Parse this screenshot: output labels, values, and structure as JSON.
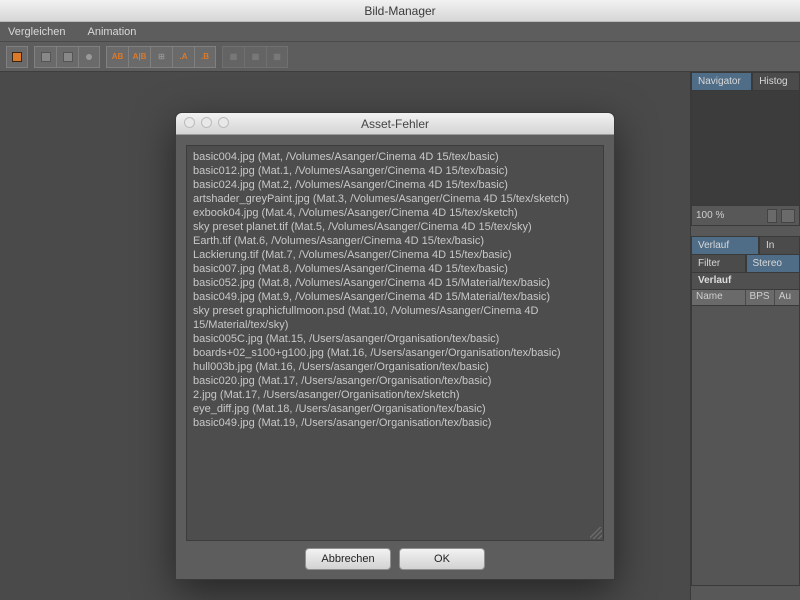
{
  "window": {
    "title": "Bild-Manager"
  },
  "menubar": {
    "items": [
      "Vergleichen",
      "Animation"
    ]
  },
  "sidepanel": {
    "tabs_top": [
      {
        "label": "Navigator",
        "active": true
      },
      {
        "label": "Histog",
        "active": false
      }
    ],
    "zoom": {
      "value": "100 %"
    },
    "tabs_mid": [
      {
        "label": "Verlauf",
        "active": true
      },
      {
        "label": "In",
        "active": false
      }
    ],
    "tabs_low": [
      {
        "label": "Filter",
        "active": false
      },
      {
        "label": "Stereo",
        "active": true
      }
    ],
    "section": {
      "title": "Verlauf"
    },
    "columns": [
      "Name",
      "BPS",
      "Au"
    ]
  },
  "dialog": {
    "title": "Asset-Fehler",
    "lines": [
      "basic004.jpg (Mat, /Volumes/Asanger/Cinema 4D 15/tex/basic)",
      "basic012.jpg (Mat.1, /Volumes/Asanger/Cinema 4D 15/tex/basic)",
      "basic024.jpg (Mat.2, /Volumes/Asanger/Cinema 4D 15/tex/basic)",
      "artshader_greyPaint.jpg (Mat.3, /Volumes/Asanger/Cinema 4D 15/tex/sketch)",
      "exbook04.jpg (Mat.4, /Volumes/Asanger/Cinema 4D 15/tex/sketch)",
      "sky preset planet.tif (Mat.5, /Volumes/Asanger/Cinema 4D 15/tex/sky)",
      "Earth.tif (Mat.6, /Volumes/Asanger/Cinema 4D 15/tex/basic)",
      "Lackierung.tif (Mat.7, /Volumes/Asanger/Cinema 4D 15/tex/basic)",
      "basic007.jpg (Mat.8, /Volumes/Asanger/Cinema 4D 15/tex/basic)",
      "basic052.jpg (Mat.8, /Volumes/Asanger/Cinema 4D 15/Material/tex/basic)",
      "basic049.jpg (Mat.9, /Volumes/Asanger/Cinema 4D 15/Material/tex/basic)",
      "sky preset graphicfullmoon.psd (Mat.10, /Volumes/Asanger/Cinema 4D 15/Material/tex/sky)",
      "basic005C.jpg (Mat.15, /Users/asanger/Organisation/tex/basic)",
      "boards+02_s100+g100.jpg (Mat.16, /Users/asanger/Organisation/tex/basic)",
      "hull003b.jpg (Mat.16, /Users/asanger/Organisation/tex/basic)",
      "basic020.jpg (Mat.17, /Users/asanger/Organisation/tex/basic)",
      "2.jpg (Mat.17, /Users/asanger/Organisation/tex/sketch)",
      "eye_diff.jpg (Mat.18, /Users/asanger/Organisation/tex/basic)",
      "basic049.jpg (Mat.19, /Users/asanger/Organisation/tex/basic)"
    ],
    "buttons": {
      "cancel": "Abbrechen",
      "ok": "OK"
    }
  }
}
